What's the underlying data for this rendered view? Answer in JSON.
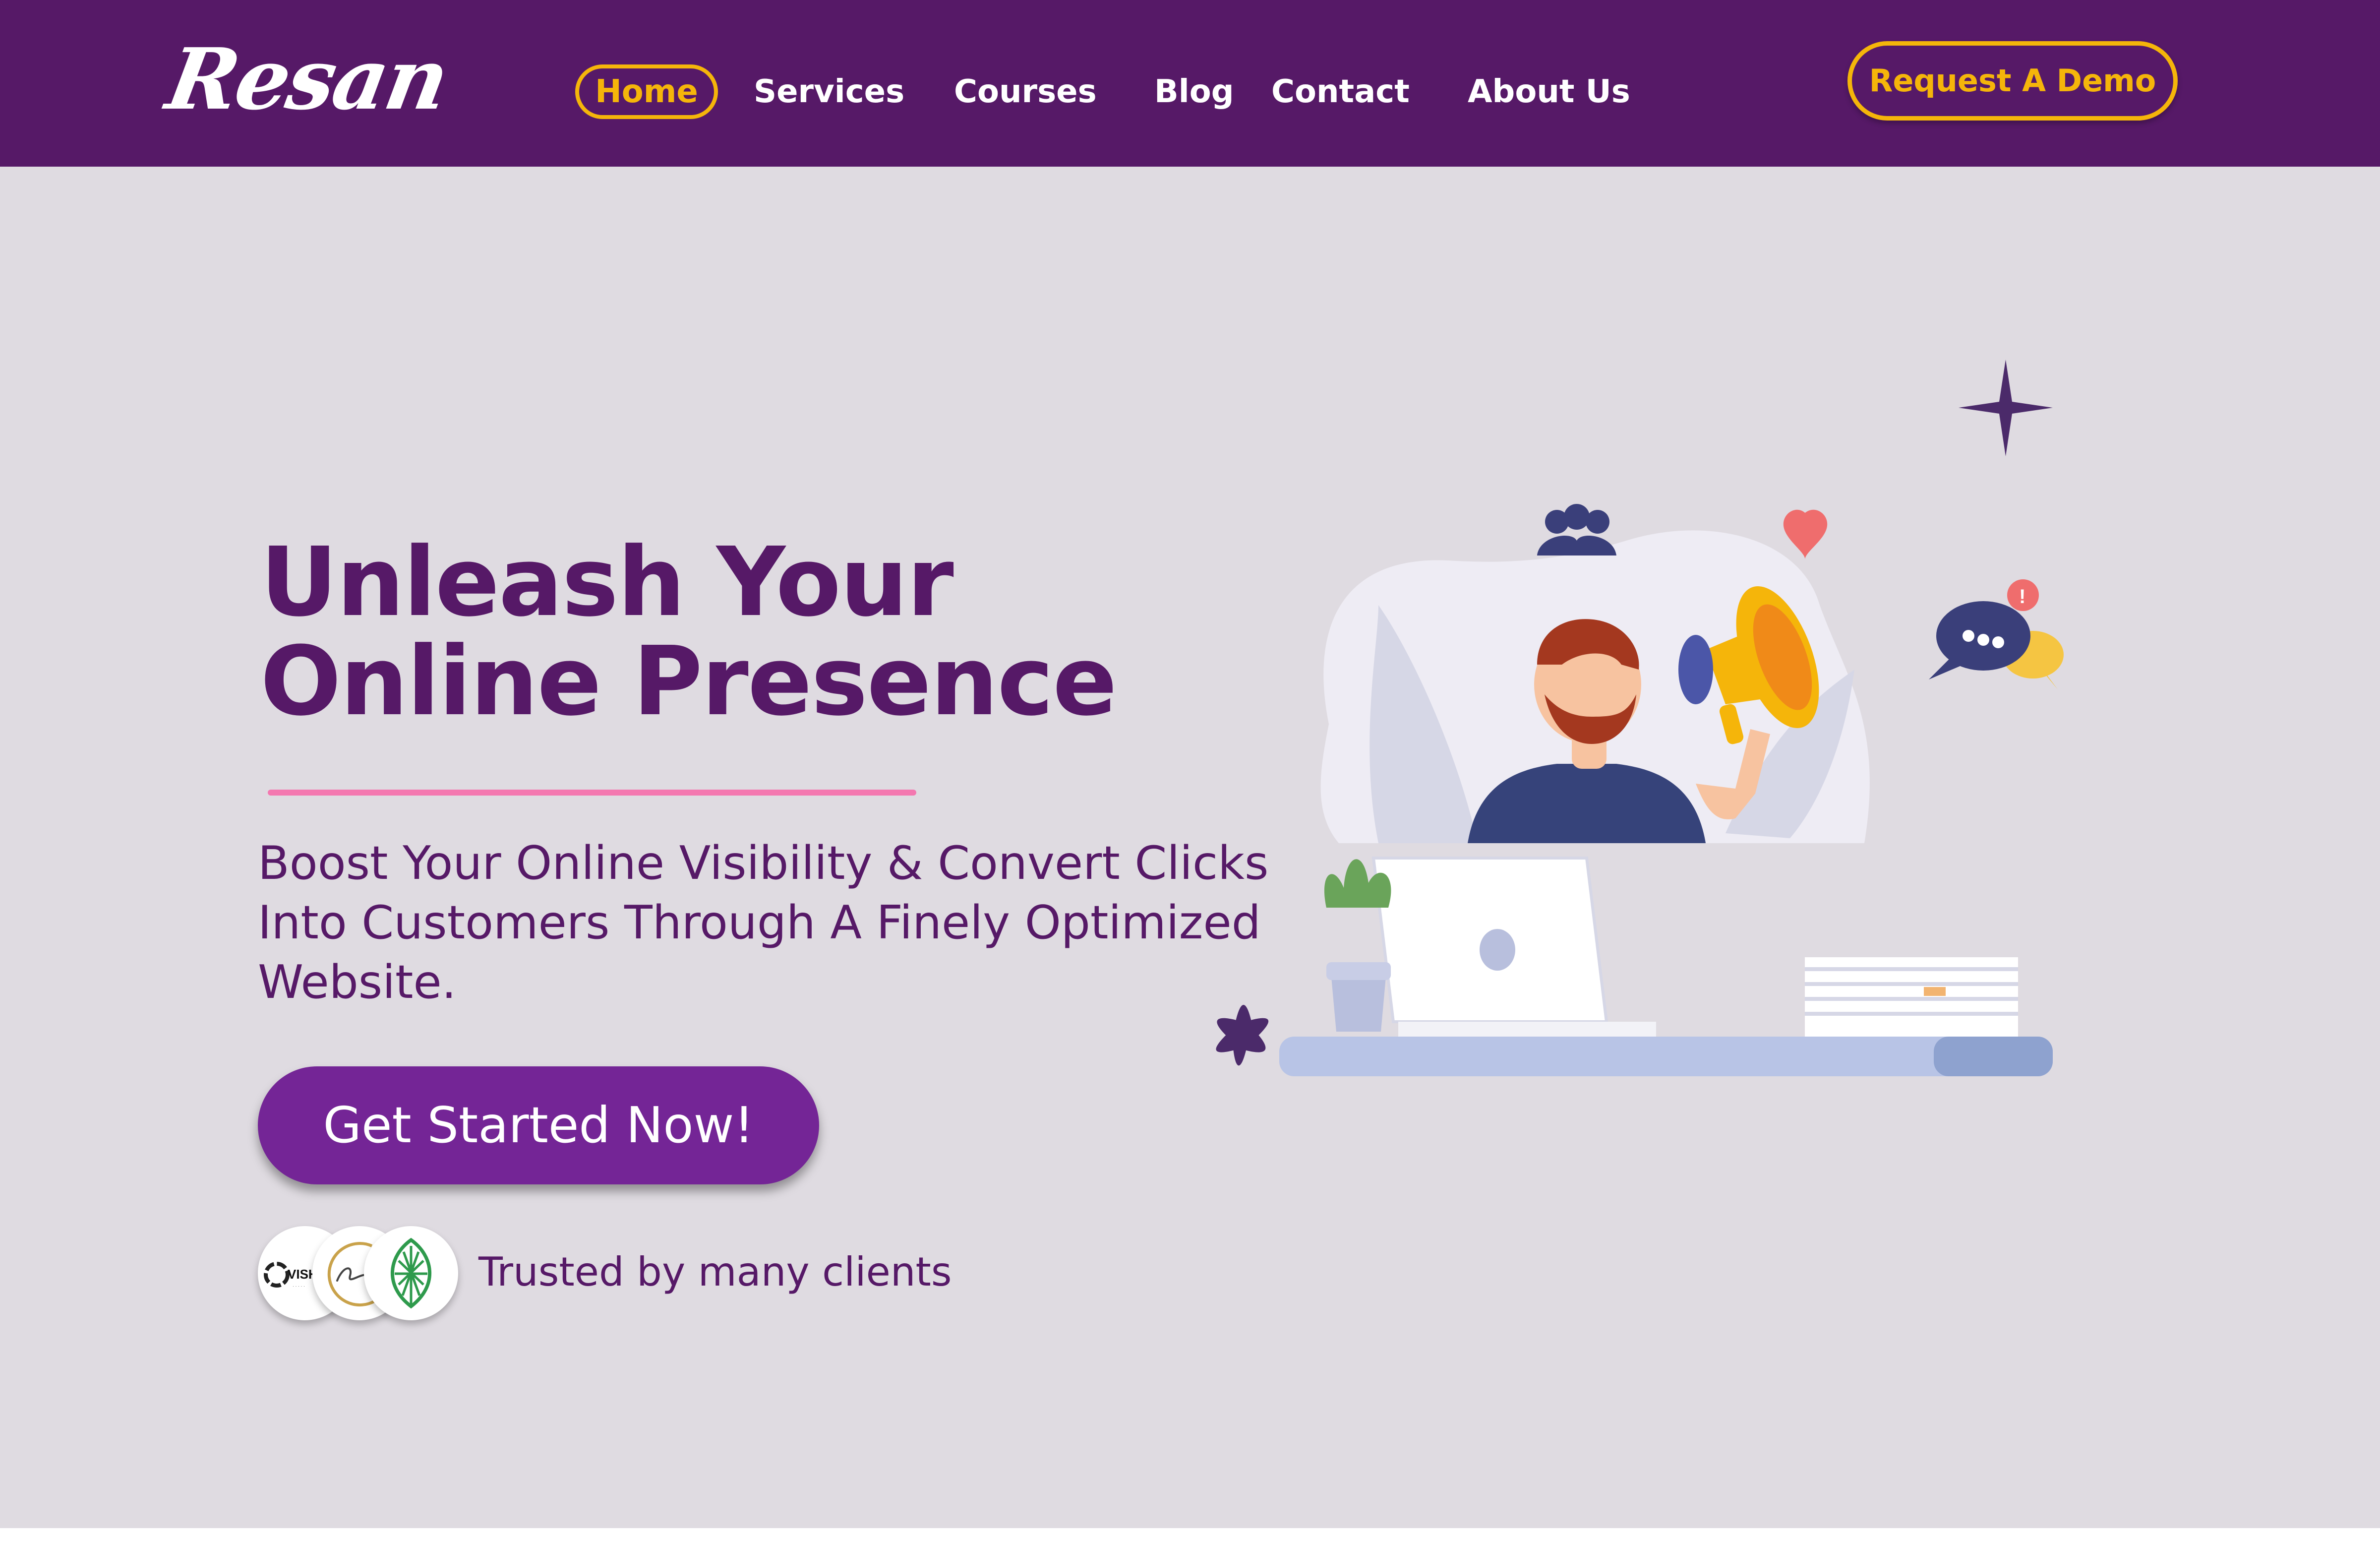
{
  "brand": {
    "logo_text": "Resan"
  },
  "nav": {
    "items": [
      {
        "label": "Home",
        "active": true
      },
      {
        "label": "Services"
      },
      {
        "label": "Courses"
      },
      {
        "label": "Blog"
      },
      {
        "label": "Contact"
      },
      {
        "label": "About Us"
      }
    ],
    "cta_label": "Request A Demo"
  },
  "hero": {
    "headline_line1": "Unleash Your",
    "headline_line2": "Online Presence",
    "subtext": "Boost Your Online Visibility & Convert Clicks Into Customers Through A Finely Optimized Website.",
    "cta_label": "Get Started Now!",
    "trusted_text": "Trusted by many clients",
    "client_logos": [
      {
        "icon": "vishva-logo",
        "text": "VISHVA"
      },
      {
        "icon": "script-signature-logo",
        "text": ""
      },
      {
        "icon": "leaf-pinecone-logo",
        "text": ""
      }
    ]
  },
  "colors": {
    "primary_purple": "#561967",
    "button_purple": "#742596",
    "accent_yellow": "#f5b50a",
    "accent_pink": "#f478b0",
    "hero_background": "#dfdbe1"
  }
}
